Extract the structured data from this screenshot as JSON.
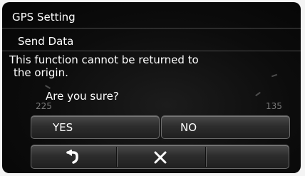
{
  "dialog": {
    "title": "GPS Setting",
    "subtitle": "Send Data",
    "message_line1": "This function cannot be returned to",
    "message_line2": "the origin.",
    "confirm_question": "Are you sure?"
  },
  "background": {
    "heading_left": "225",
    "heading_right": "135"
  },
  "buttons": {
    "yes_label": "YES",
    "no_label": "NO"
  },
  "toolbar": {
    "back_icon": "return-arrow-icon",
    "close_icon": "close-x-icon"
  },
  "colors": {
    "text": "#ffffff",
    "screen_background": "#0c0c0c",
    "button_gradient_top": "#4a4a4a",
    "button_gradient_bottom": "#1f1f1f"
  }
}
